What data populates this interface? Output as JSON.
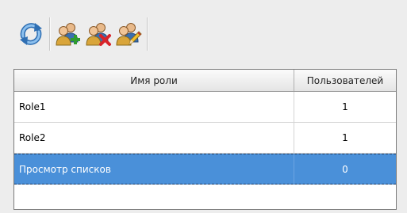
{
  "toolbar": {
    "buttons": [
      {
        "name": "refresh",
        "icon": "refresh-icon"
      },
      {
        "name": "add-role",
        "icon": "users-add-icon"
      },
      {
        "name": "delete-role",
        "icon": "users-delete-icon"
      },
      {
        "name": "edit-role",
        "icon": "users-edit-icon"
      }
    ]
  },
  "table": {
    "columns": [
      "Имя роли",
      "Пользователей"
    ],
    "rows": [
      {
        "name": "Role1",
        "count": "1"
      },
      {
        "name": "Role2",
        "count": "1"
      },
      {
        "name": "Просмотр списков",
        "count": "0"
      }
    ],
    "selected_row": 2
  },
  "colors": {
    "selection": "#4a90d9",
    "refresh_icon": "#3a7fc4"
  }
}
